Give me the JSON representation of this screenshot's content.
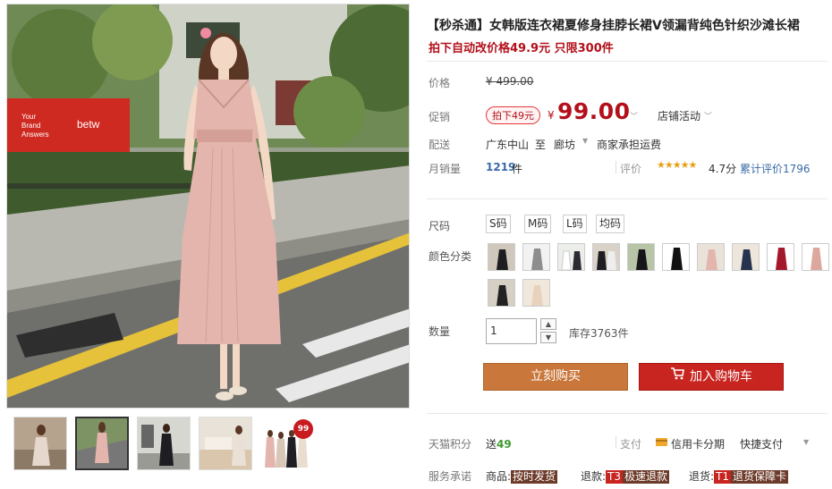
{
  "product": {
    "title": "【秒杀通】女韩版连衣裙夏修身挂脖长裙V领漏背纯色针织沙滩长裙",
    "subtitle": "拍下自动改价格49.9元 只限300件"
  },
  "price": {
    "label": "价格",
    "original": "¥ 499.00",
    "promo_label": "促销",
    "promo_pill": "拍下49元",
    "currency": "¥",
    "current": "99.00",
    "shop_activity": "店铺活动"
  },
  "shipping": {
    "label": "配送",
    "from": "广东中山",
    "to_word": "至",
    "to": "廊坊",
    "fee": "商家承担运费"
  },
  "stats": {
    "sales_label": "月销量",
    "sales": "1219",
    "sales_unit": "件",
    "rating_label": "评价",
    "stars": "★★★★★",
    "rating": "4.7分",
    "reviews": "累计评价1796"
  },
  "size": {
    "label": "尺码",
    "options": [
      "S码",
      "M码",
      "L码",
      "均码"
    ]
  },
  "color": {
    "label": "颜色分类",
    "swatches": [
      "black-dress-1",
      "grey-dress",
      "white-pair",
      "black-pair",
      "black-dress-2",
      "black-dress-3",
      "pink-dress",
      "navy-dress",
      "red-dress",
      "pink-dress-2",
      "black-dress-4",
      "beige-dress"
    ]
  },
  "quantity": {
    "label": "数量",
    "value": "1",
    "stock": "库存3763件"
  },
  "buttons": {
    "buy": "立刻购买",
    "cart": "加入购物车"
  },
  "points": {
    "label": "天猫积分",
    "prefix": "送",
    "value": "49"
  },
  "payment": {
    "label": "支付",
    "credit": "信用卡分期",
    "quick": "快捷支付"
  },
  "service": {
    "label": "服务承诺",
    "goods_label": "商品:",
    "goods_tag": "按时发货",
    "refund_label": "退款:",
    "refund_tag_code": "T3",
    "refund_tag": "极速退款",
    "return_label": "退货:",
    "return_tag_code": "T1",
    "return_tag": "退货保障卡"
  },
  "thumbnails": {
    "badge": "99"
  },
  "colors": {
    "price_red": "#b3101b",
    "buy_orange": "#c9773b",
    "cart_red": "#c82520",
    "dress_pink": "#e3b5ad"
  }
}
